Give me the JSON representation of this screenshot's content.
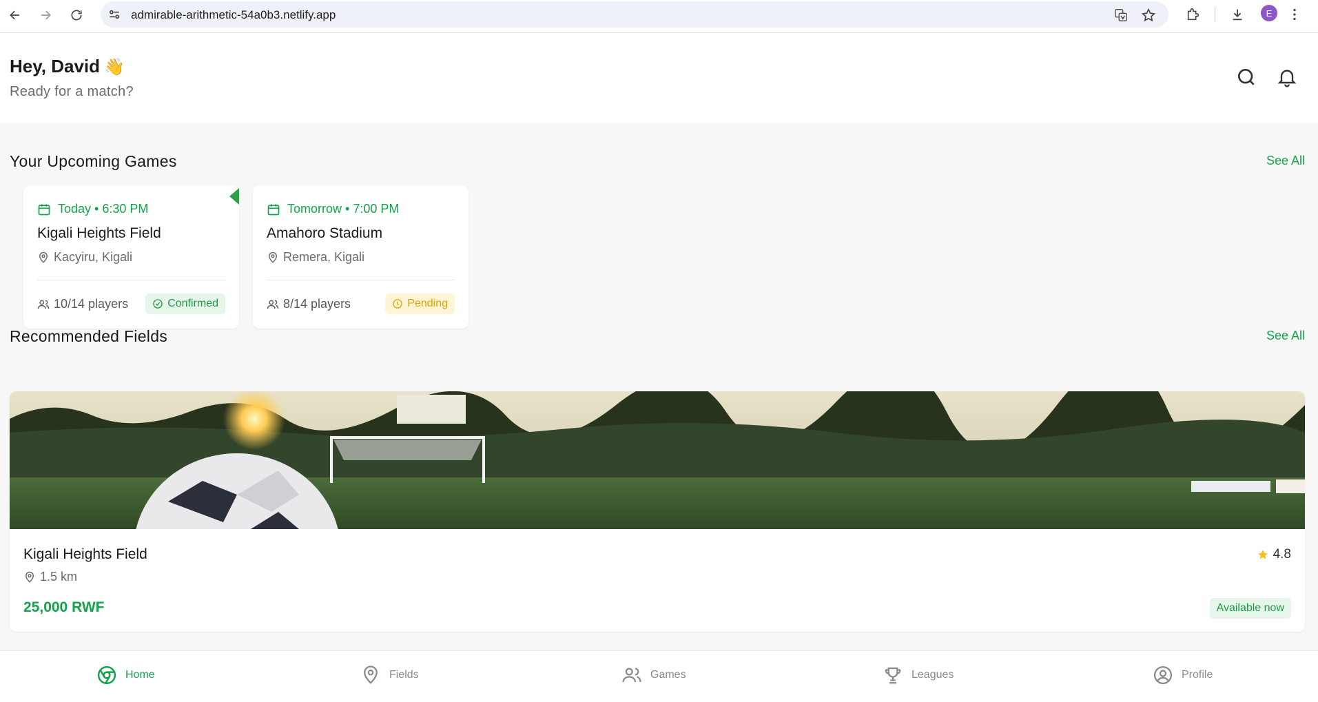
{
  "browser": {
    "url": "admirable-arithmetic-54a0b3.netlify.app",
    "profile_initial": "E"
  },
  "header": {
    "greeting": "Hey, David",
    "wave_emoji": "👋",
    "subtitle": "Ready for a match?"
  },
  "upcoming": {
    "title": "Your Upcoming Games",
    "see_all": "See All",
    "games": [
      {
        "date": "Today • 6:30 PM",
        "field": "Kigali Heights Field",
        "location": "Kacyiru, Kigali",
        "players": "10/14 players",
        "status": "Confirmed"
      },
      {
        "date": "Tomorrow • 7:00 PM",
        "field": "Amahoro Stadium",
        "location": "Remera, Kigali",
        "players": "8/14 players",
        "status": "Pending"
      }
    ]
  },
  "recommended": {
    "title": "Recommended Fields",
    "see_all": "See All",
    "fields": [
      {
        "name": "Kigali Heights Field",
        "distance": "1.5 km",
        "rating": "4.8",
        "price": "25,000 RWF",
        "availability": "Available now"
      }
    ]
  },
  "nav": {
    "items": [
      {
        "label": "Home",
        "icon": "home-icon"
      },
      {
        "label": "Fields",
        "icon": "map-pin-icon"
      },
      {
        "label": "Games",
        "icon": "users-icon"
      },
      {
        "label": "Leagues",
        "icon": "trophy-icon"
      },
      {
        "label": "Profile",
        "icon": "user-circle-icon"
      }
    ],
    "active": "Home"
  },
  "colors": {
    "accent": "#13a34a",
    "pending": "#e0a400",
    "background": "#f7f7f7"
  }
}
